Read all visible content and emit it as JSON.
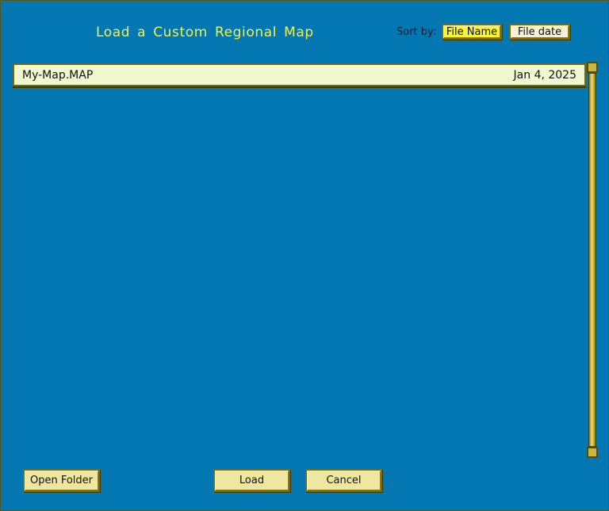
{
  "dialog": {
    "title": "Load a Custom Regional Map"
  },
  "sort": {
    "label": "Sort by:",
    "by_name": "File Name",
    "by_date": "File date",
    "active": "File Name"
  },
  "files": [
    {
      "name": "My-Map.MAP",
      "date": "Jan 4, 2025"
    }
  ],
  "buttons": {
    "open_folder": "Open Folder",
    "load": "Load",
    "cancel": "Cancel"
  },
  "colors": {
    "background": "#0277b1",
    "title": "#f4f24a",
    "active_sort": "#f7f53a",
    "button_face": "#efe6a0",
    "row": "#eef9d0"
  }
}
